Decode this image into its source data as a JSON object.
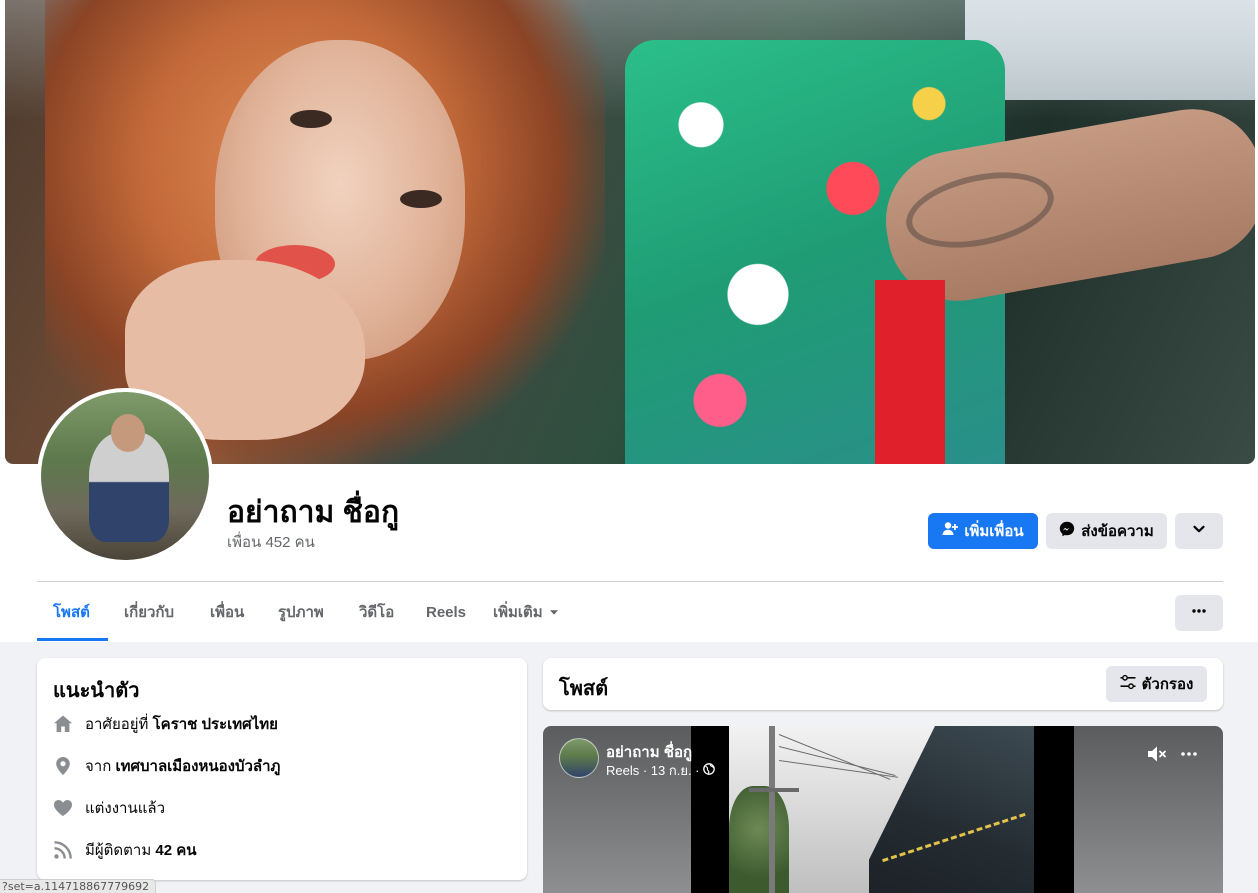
{
  "profile": {
    "name": "อย่าถาม ชื่อกู",
    "friends_count_text": "เพื่อน 452 คน"
  },
  "actions": {
    "add_friend_label": "เพิ่มเพื่อน",
    "message_label": "ส่งข้อความ"
  },
  "tabs": [
    {
      "label": "โพสต์",
      "active": true
    },
    {
      "label": "เกี่ยวกับ"
    },
    {
      "label": "เพื่อน"
    },
    {
      "label": "รูปภาพ"
    },
    {
      "label": "วิดีโอ"
    },
    {
      "label": "Reels"
    },
    {
      "label": "เพิ่มเติม"
    }
  ],
  "intro": {
    "title": "แนะนำตัว",
    "lives_prefix": "อาศัยอยู่ที่",
    "lives_value": "โคราช ประเทศไทย",
    "from_prefix": "จาก",
    "from_value": "เทศบาลเมืองหนองบัวลำภู",
    "relationship": "แต่งงานแล้ว",
    "followers_prefix": "มีผู้ติดตาม",
    "followers_value": "42 คน"
  },
  "posts": {
    "title": "โพสต์",
    "filter_label": "ตัวกรอง"
  },
  "reel": {
    "author": "อย่าถาม ชื่อกู",
    "meta": "Reels · 13 ก.ย. ·"
  },
  "status_bar": {
    "url_fragment": "?set=a.114718867779692"
  },
  "colors": {
    "accent": "#1877f2",
    "page_bg": "#f0f2f5",
    "secondary_button": "#e4e6eb",
    "muted_text": "#65676b"
  },
  "icons": {
    "add_friend": "person-plus-icon",
    "messenger": "messenger-icon",
    "chevron": "chevron-down-icon",
    "more": "more-dots-icon",
    "home": "home-icon",
    "location": "location-pin-icon",
    "relationship": "heart-icon",
    "followers": "rss-feed-icon",
    "filter": "filter-sliders-icon",
    "mute": "speaker-muted-icon",
    "privacy": "globe-icon"
  }
}
